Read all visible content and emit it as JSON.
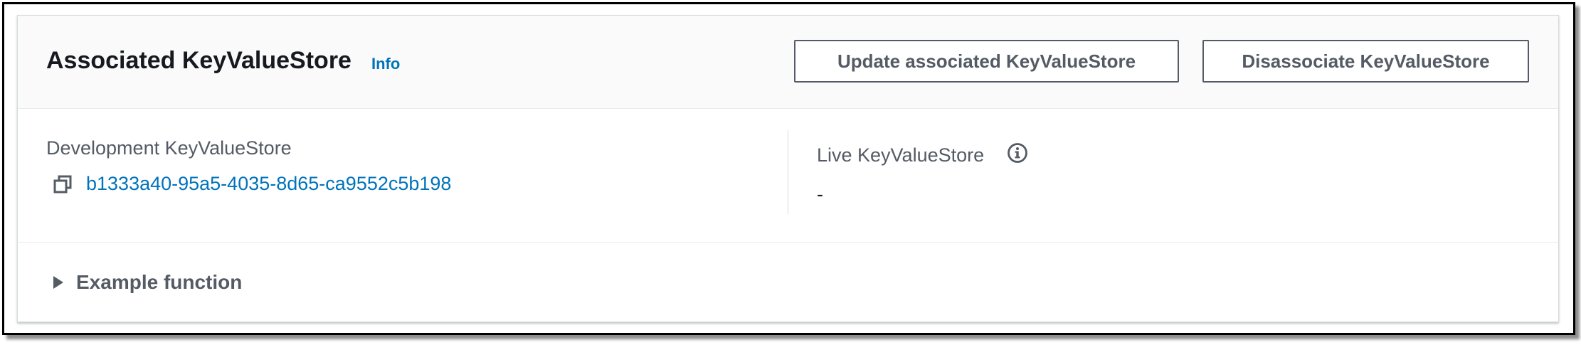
{
  "section": {
    "title": "Associated KeyValueStore",
    "info_link": "Info",
    "buttons": {
      "update": "Update associated KeyValueStore",
      "disassociate": "Disassociate KeyValueStore"
    }
  },
  "development": {
    "label": "Development KeyValueStore",
    "value": "b1333a40-95a5-4035-8d65-ca9552c5b198",
    "icon": "copy-icon"
  },
  "live": {
    "label": "Live KeyValueStore",
    "value": "-",
    "icon": "info-circle-icon"
  },
  "expandable": {
    "label": "Example function",
    "expanded": false,
    "icon": "caret-right-icon"
  },
  "colors": {
    "link": "#0073bb",
    "text_primary": "#16191f",
    "text_secondary": "#545b64",
    "border": "#d5dbdb"
  }
}
